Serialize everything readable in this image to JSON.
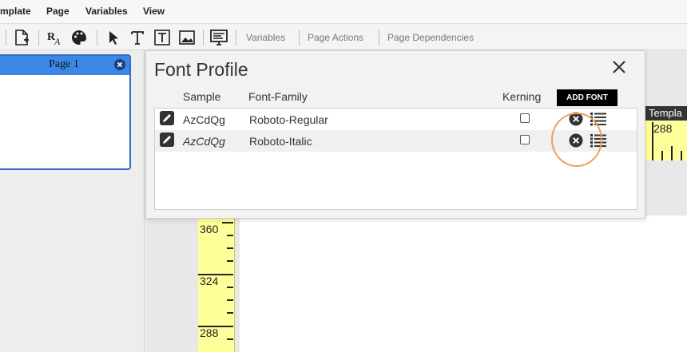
{
  "menubar": {
    "items": [
      "mplate",
      "Page",
      "Variables",
      "View"
    ]
  },
  "toolbar": {
    "text_items": [
      "Variables",
      "Page Actions",
      "Page Dependencies"
    ]
  },
  "left_pane": {
    "page_thumb_label": "Page 1"
  },
  "canvas": {
    "ruler_v_labels": [
      "360",
      "324",
      "288"
    ],
    "ruler_h_title": "Templa",
    "ruler_h_label": "288"
  },
  "dialog": {
    "title": "Font Profile",
    "columns": {
      "sample": "Sample",
      "family": "Font-Family",
      "kerning": "Kerning"
    },
    "add_font_label": "ADD FONT",
    "rows": [
      {
        "sample": "AzCdQg",
        "family": "Roboto-Regular",
        "kerning": false,
        "italic": false
      },
      {
        "sample": "AzCdQg",
        "family": "Roboto-Italic",
        "kerning": false,
        "italic": true
      }
    ]
  },
  "colors": {
    "thumb_header": "#3c86e6",
    "ruler": "#ffff99",
    "highlight": "#f0a050"
  }
}
